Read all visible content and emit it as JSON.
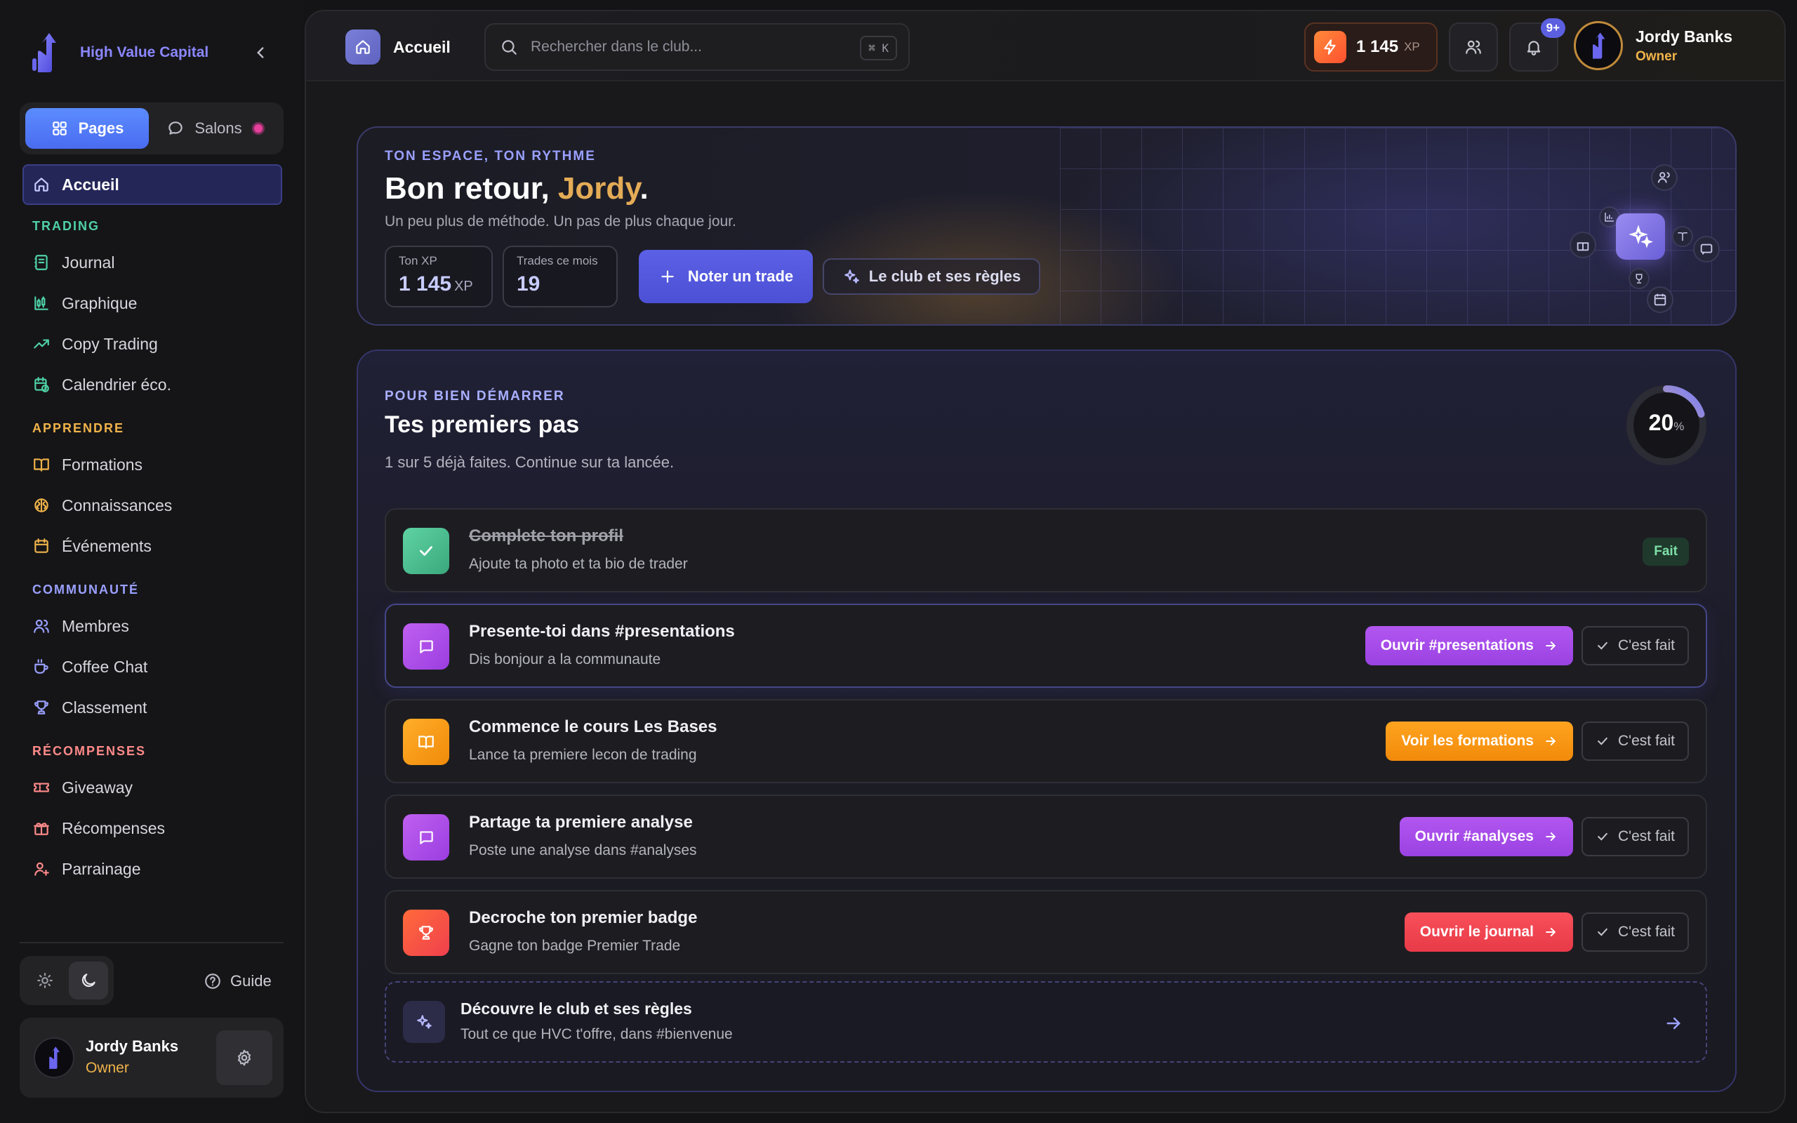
{
  "sidebar": {
    "brand": "High Value Capital",
    "tabs": {
      "pages": "Pages",
      "salons": "Salons"
    },
    "active": "Accueil",
    "sections": [
      {
        "label": "TRADING",
        "color": "#4fd1a5",
        "items": [
          "Journal",
          "Graphique",
          "Copy Trading",
          "Calendrier éco."
        ]
      },
      {
        "label": "APPRENDRE",
        "color": "#f0b34a",
        "items": [
          "Formations",
          "Connaissances",
          "Événements"
        ]
      },
      {
        "label": "COMMUNAUTÉ",
        "color": "#9aa0ff",
        "items": [
          "Membres",
          "Coffee Chat",
          "Classement"
        ]
      },
      {
        "label": "RÉCOMPENSES",
        "color": "#ff8a8a",
        "items": [
          "Giveaway",
          "Récompenses",
          "Parrainage"
        ]
      }
    ],
    "guide": "Guide",
    "user": {
      "name": "Jordy Banks",
      "role": "Owner"
    }
  },
  "topbar": {
    "page": "Accueil",
    "search_placeholder": "Rechercher dans le club...",
    "shortcut": "⌘ K",
    "xp_value": "1 145",
    "xp_unit": "XP",
    "notif_badge": "9+",
    "user": {
      "name": "Jordy Banks",
      "role": "Owner"
    }
  },
  "hero": {
    "kicker": "TON ESPACE, TON RYTHME",
    "greeting": "Bon retour, ",
    "name": "Jordy",
    "punct": ".",
    "subtitle": "Un peu plus de méthode. Un pas de plus chaque jour.",
    "stats": [
      {
        "label": "Ton XP",
        "value": "1 145",
        "unit": "XP"
      },
      {
        "label": "Trades ce mois",
        "value": "19"
      }
    ],
    "primary_cta": "Noter un trade",
    "secondary_cta": "Le club et ses règles"
  },
  "onboarding": {
    "kicker": "POUR BIEN DÉMARRER",
    "title": "Tes premiers pas",
    "subtitle": "1 sur 5 déjà faites. Continue sur ta lancée.",
    "progress_percent": 20,
    "progress_label": "20",
    "progress_unit": "%",
    "done_label": "C'est fait",
    "done_badge": "Fait",
    "tasks": [
      {
        "title": "Complete ton profil",
        "desc": "Ajoute ta photo et ta bio de trader",
        "done": true,
        "icon": "check-icon",
        "color": "#4fc597"
      },
      {
        "title": "Presente-toi dans #presentations",
        "desc": "Dis bonjour a la communaute",
        "cta": "Ouvrir #presentations",
        "icon": "message-icon",
        "color": "#b04ee8"
      },
      {
        "title": "Commence le cours Les Bases",
        "desc": "Lance ta premiere lecon de trading",
        "cta": "Voir les formations",
        "icon": "book-icon",
        "color": "#f59a16"
      },
      {
        "title": "Partage ta premiere analyse",
        "desc": "Poste une analyse dans #analyses",
        "cta": "Ouvrir #analyses",
        "icon": "message-icon",
        "color": "#b04ee8"
      },
      {
        "title": "Decroche ton premier badge",
        "desc": "Gagne ton badge Premier Trade",
        "cta": "Ouvrir le journal",
        "icon": "trophy-icon",
        "color": "#f0484e"
      }
    ],
    "discover": {
      "title": "Découvre le club et ses règles",
      "desc": "Tout ce que HVC t'offre, dans #bienvenue"
    }
  }
}
